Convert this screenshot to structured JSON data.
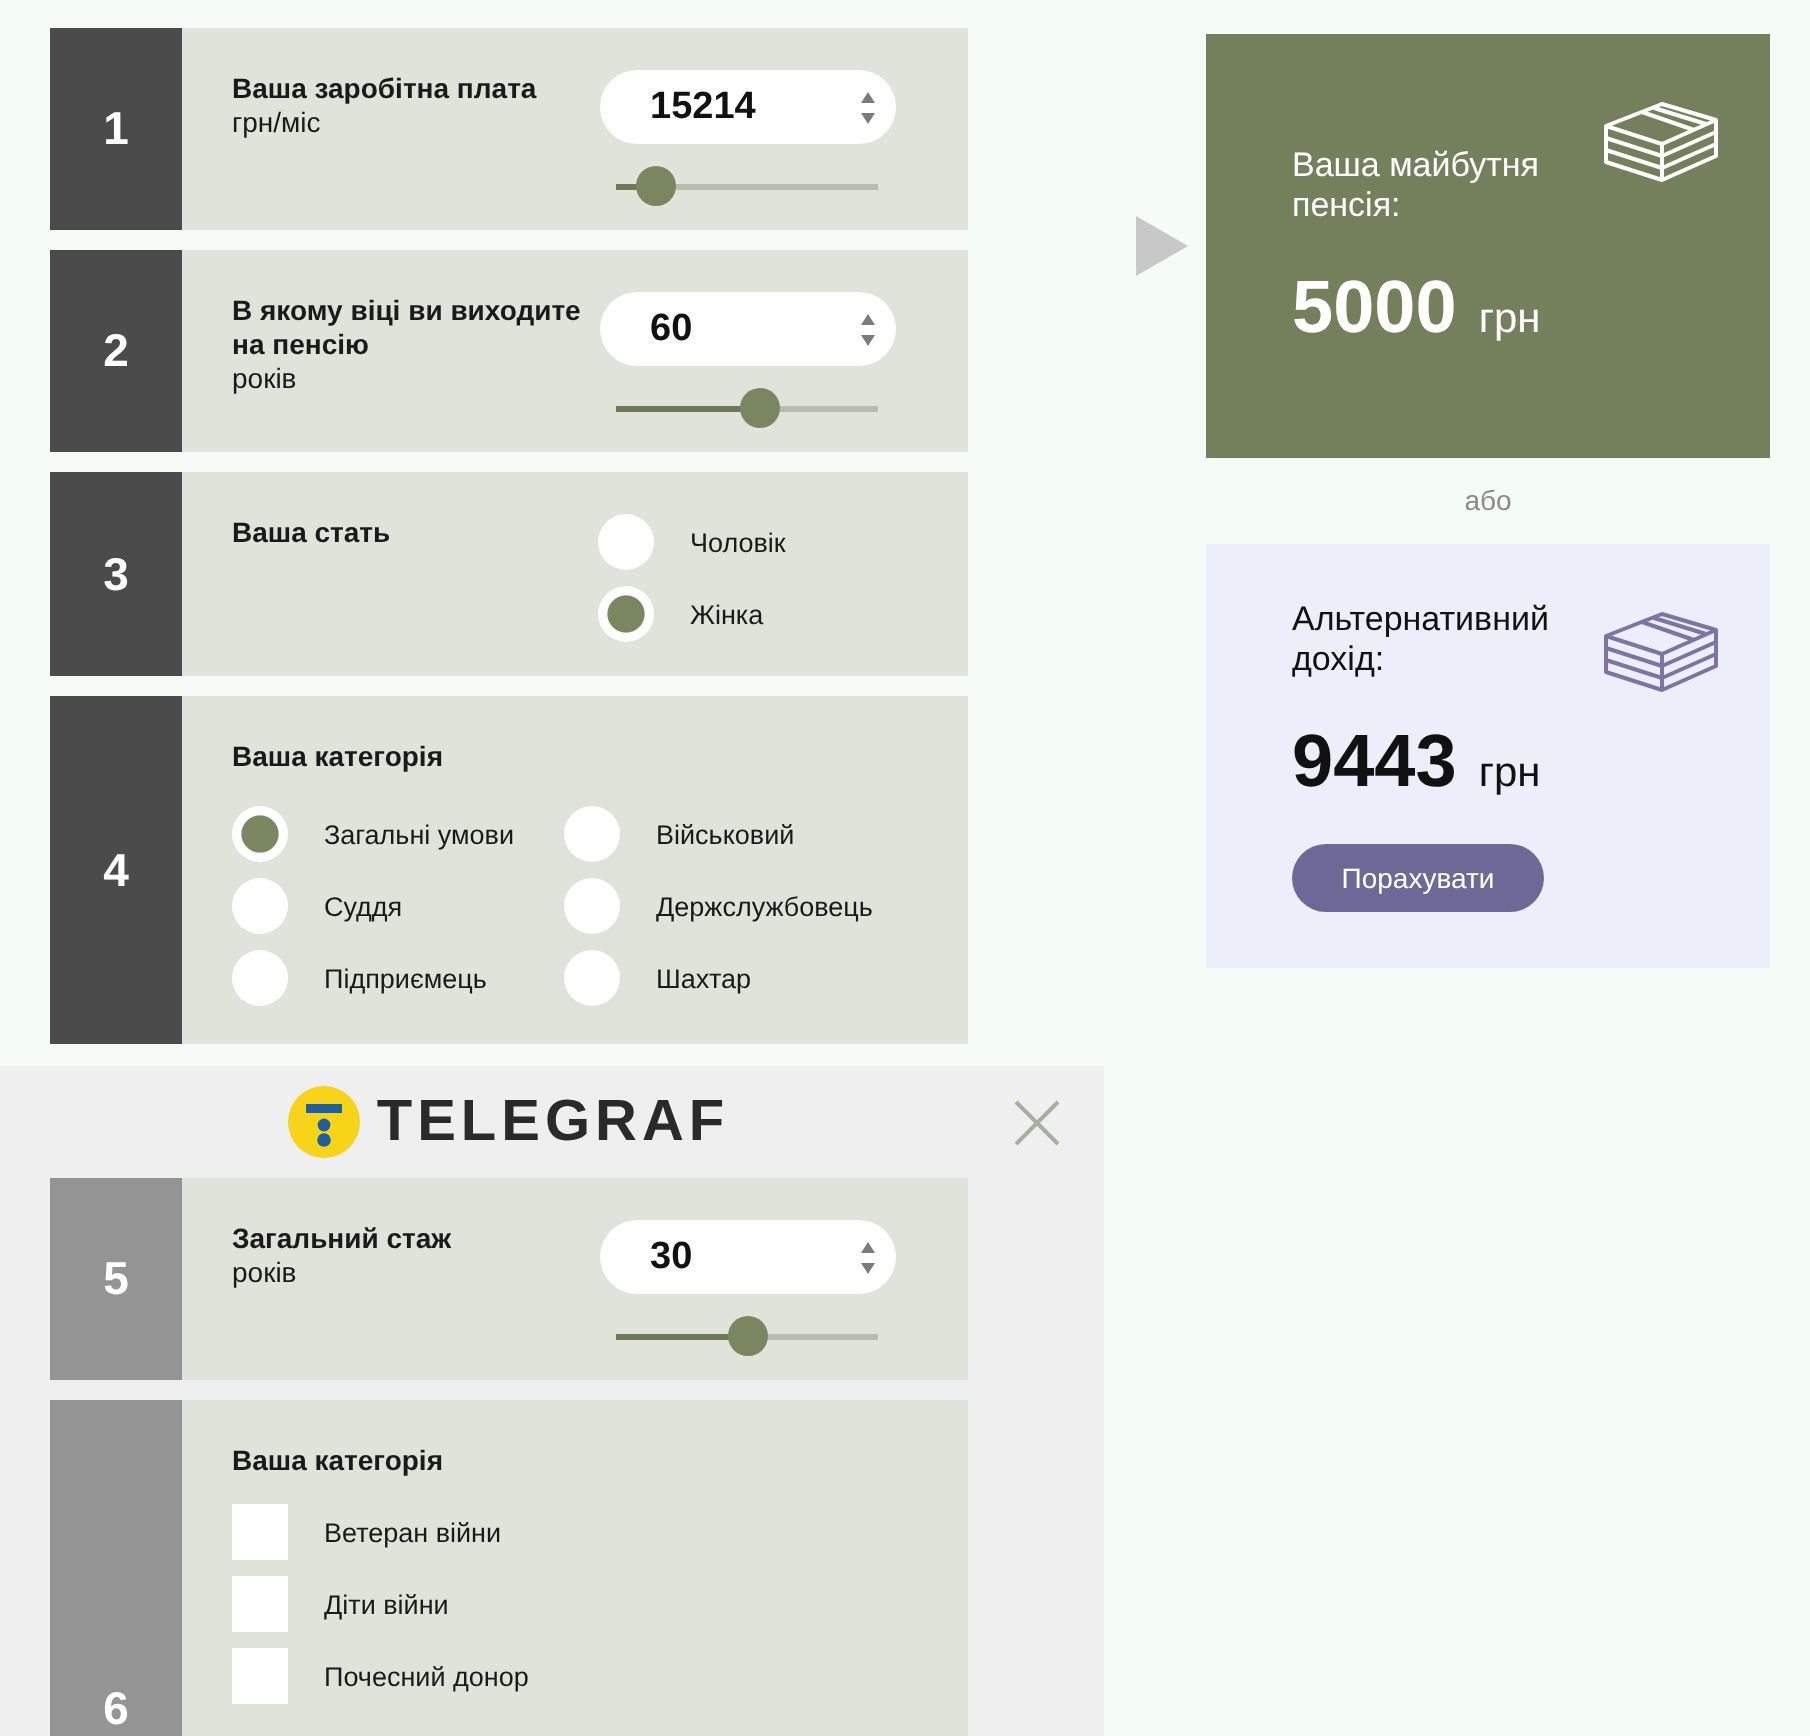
{
  "steps": [
    {
      "number": "1",
      "kind": "number",
      "title": "Ваша заробітна плата",
      "unit": "грн/міс",
      "value": "15214",
      "level": 0.15
    },
    {
      "number": "2",
      "kind": "number",
      "title": "В якому віці ви виходите на пенсію",
      "unit": "років",
      "value": "60",
      "level": 0.55
    },
    {
      "number": "3",
      "kind": "radio",
      "title": "Ваша стать",
      "options": [
        {
          "label": "Чоловік",
          "selected": false
        },
        {
          "label": "Жінка",
          "selected": true
        }
      ]
    },
    {
      "number": "4",
      "kind": "radio",
      "title": "Ваша категорія",
      "options": [
        {
          "label": "Загальні умови",
          "selected": true
        },
        {
          "label": "Військовий",
          "selected": false
        },
        {
          "label": "Суддя",
          "selected": false
        },
        {
          "label": "Держслужбовець",
          "selected": false
        },
        {
          "label": "Підприємець",
          "selected": false
        },
        {
          "label": "Шахтар",
          "selected": false
        }
      ]
    }
  ],
  "pension": {
    "label": "Ваша майбутня пенсія:",
    "amount": "5000",
    "currency": "грн"
  },
  "separator": "або",
  "alternative": {
    "label": "Альтернативний дохід:",
    "amount": "9443",
    "currency": "грн",
    "button": "Порахувати"
  },
  "banner": {
    "logo_text": "TELEGRAF",
    "steps": [
      {
        "number": "5",
        "kind": "number",
        "title": "Загальний стаж",
        "unit": "років",
        "value": "30",
        "level": 0.5
      },
      {
        "number": "6",
        "kind": "checkbox",
        "title": "Ваша категорія",
        "options": [
          {
            "label": "Ветеран війни",
            "checked": false
          },
          {
            "label": "Діти війни",
            "checked": false
          },
          {
            "label": "Почесний донор",
            "checked": false
          }
        ]
      }
    ]
  }
}
